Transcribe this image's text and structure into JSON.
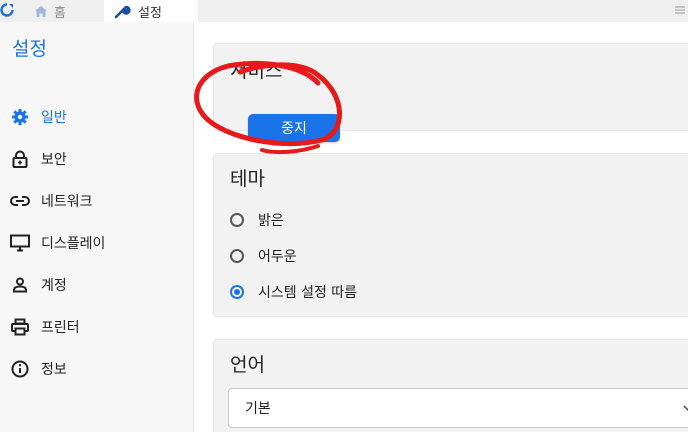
{
  "tabs": [
    {
      "label": "홈",
      "icon": "home-icon"
    },
    {
      "label": "설정",
      "icon": "wrench-icon"
    }
  ],
  "sidebar": {
    "title": "설정",
    "items": [
      {
        "label": "일반",
        "icon": "gear-icon",
        "active": true
      },
      {
        "label": "보안",
        "icon": "lock-icon"
      },
      {
        "label": "네트워크",
        "icon": "link-icon"
      },
      {
        "label": "디스플레이",
        "icon": "monitor-icon"
      },
      {
        "label": "계정",
        "icon": "person-icon"
      },
      {
        "label": "프린터",
        "icon": "printer-icon"
      },
      {
        "label": "정보",
        "icon": "info-icon"
      }
    ]
  },
  "service": {
    "title": "서비스",
    "stop_label": "중지"
  },
  "theme": {
    "title": "테마",
    "options": [
      {
        "label": "밝은",
        "checked": false
      },
      {
        "label": "어두운",
        "checked": false
      },
      {
        "label": "시스템 설정 따름",
        "checked": true
      }
    ]
  },
  "language": {
    "title": "언어",
    "selected": "기본"
  },
  "colors": {
    "accent": "#1a73e8",
    "annotation": "#e8191a"
  }
}
